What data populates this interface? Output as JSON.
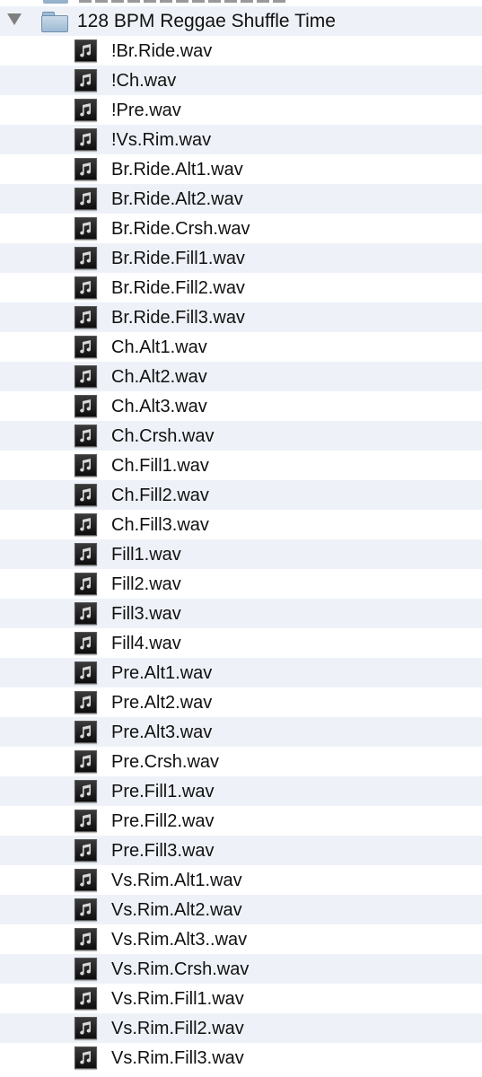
{
  "folder": {
    "name": "128 BPM Reggae Shuffle Time",
    "icon": "folder-icon",
    "disclosure_icon": "disclosure-triangle-expanded-icon"
  },
  "file_icon": "audio-file-icon",
  "files": [
    "!Br.Ride.wav",
    "!Ch.wav",
    "!Pre.wav",
    "!Vs.Rim.wav",
    "Br.Ride.Alt1.wav",
    "Br.Ride.Alt2.wav",
    "Br.Ride.Crsh.wav",
    "Br.Ride.Fill1.wav",
    "Br.Ride.Fill2.wav",
    "Br.Ride.Fill3.wav",
    "Ch.Alt1.wav",
    "Ch.Alt2.wav",
    "Ch.Alt3.wav",
    "Ch.Crsh.wav",
    "Ch.Fill1.wav",
    "Ch.Fill2.wav",
    "Ch.Fill3.wav",
    "Fill1.wav",
    "Fill2.wav",
    "Fill3.wav",
    "Fill4.wav",
    "Pre.Alt1.wav",
    "Pre.Alt2.wav",
    "Pre.Alt3.wav",
    "Pre.Crsh.wav",
    "Pre.Fill1.wav",
    "Pre.Fill2.wav",
    "Pre.Fill3.wav",
    "Vs.Rim.Alt1.wav",
    "Vs.Rim.Alt2.wav",
    "Vs.Rim.Alt3..wav",
    "Vs.Rim.Crsh.wav",
    "Vs.Rim.Fill1.wav",
    "Vs.Rim.Fill2.wav",
    "Vs.Rim.Fill3.wav"
  ],
  "colors": {
    "row_alt": "#eef2f8",
    "row_base": "#ffffff",
    "text": "#111111"
  }
}
